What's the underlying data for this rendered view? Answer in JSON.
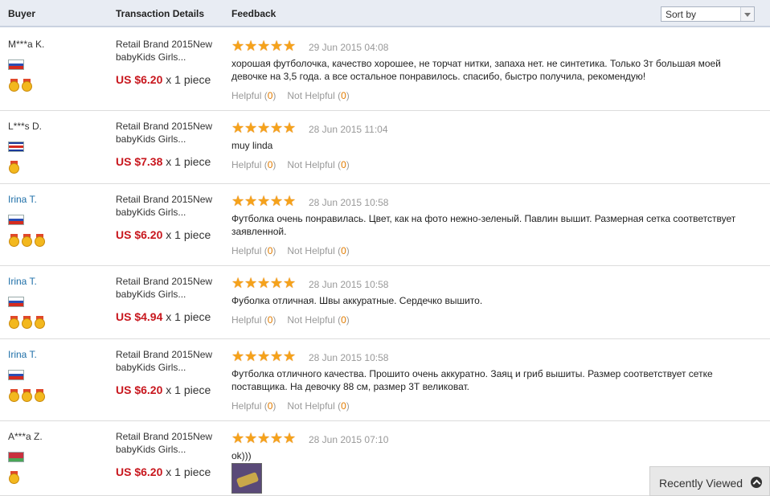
{
  "header": {
    "buyer_label": "Buyer",
    "transaction_label": "Transaction Details",
    "feedback_label": "Feedback",
    "sort_label": "Sort by"
  },
  "reviews": [
    {
      "buyer": "M***a K.",
      "buyer_is_link": false,
      "flag": "russia",
      "medal_count": 2,
      "product": "Retail Brand 2015New babyKids Girls...",
      "price": "US $6.20",
      "quantity": "x 1 piece",
      "rating": 5,
      "date": "29 Jun 2015 04:08",
      "text": "хорошая футболочка, качество хорошее, не торчат нитки, запаха нет. не синтетика. Только 3т большая моей девочке на 3,5 года. а все остальное понравилось. спасибо, быстро получила, рекомендую!",
      "helpful_label": "Helpful",
      "helpful_count": "0",
      "not_helpful_label": "Not Helpful",
      "not_helpful_count": "0"
    },
    {
      "buyer": "L***s D.",
      "buyer_is_link": false,
      "flag": "costa-rica",
      "medal_count": 1,
      "product": "Retail Brand 2015New babyKids Girls...",
      "price": "US $7.38",
      "quantity": "x 1 piece",
      "rating": 5,
      "date": "28 Jun 2015 11:04",
      "text": "muy linda",
      "helpful_label": "Helpful",
      "helpful_count": "0",
      "not_helpful_label": "Not Helpful",
      "not_helpful_count": "0"
    },
    {
      "buyer": "Irina T.",
      "buyer_is_link": true,
      "flag": "russia",
      "medal_count": 3,
      "product": "Retail Brand 2015New babyKids Girls...",
      "price": "US $6.20",
      "quantity": "x 1 piece",
      "rating": 5,
      "date": "28 Jun 2015 10:58",
      "text": "Футболка очень понравилась. Цвет, как на фото нежно-зеленый. Павлин вышит. Размерная сетка соответствует заявленной.",
      "helpful_label": "Helpful",
      "helpful_count": "0",
      "not_helpful_label": "Not Helpful",
      "not_helpful_count": "0"
    },
    {
      "buyer": "Irina T.",
      "buyer_is_link": true,
      "flag": "russia",
      "medal_count": 3,
      "product": "Retail Brand 2015New babyKids Girls...",
      "price": "US $4.94",
      "quantity": "x 1 piece",
      "rating": 5,
      "date": "28 Jun 2015 10:58",
      "text": "Фуболка отличная. Швы аккуратные. Сердечко вышито.",
      "helpful_label": "Helpful",
      "helpful_count": "0",
      "not_helpful_label": "Not Helpful",
      "not_helpful_count": "0"
    },
    {
      "buyer": "Irina T.",
      "buyer_is_link": true,
      "flag": "russia",
      "medal_count": 3,
      "product": "Retail Brand 2015New babyKids Girls...",
      "price": "US $6.20",
      "quantity": "x 1 piece",
      "rating": 5,
      "date": "28 Jun 2015 10:58",
      "text": "Футболка отличного качества. Прошито очень аккуратно. Заяц и гриб вышиты. Размер соответствует сетке поставщика. На девочку 88 см, размер 3Т великоват.",
      "helpful_label": "Helpful",
      "helpful_count": "0",
      "not_helpful_label": "Not Helpful",
      "not_helpful_count": "0"
    },
    {
      "buyer": "A***a Z.",
      "buyer_is_link": false,
      "flag": "belarus",
      "medal_count": 1,
      "product": "Retail Brand 2015New babyKids Girls...",
      "price": "US $6.20",
      "quantity": "x 1 piece",
      "rating": 5,
      "date": "28 Jun 2015 07:10",
      "text": "ok)))",
      "has_photo": true
    }
  ],
  "recently_viewed": {
    "label": "Recently Viewed"
  },
  "colors": {
    "price": "#c8171e",
    "link": "#1e6fa8",
    "star": "#f5a21b",
    "count": "#e07b00",
    "header_bg": "#e8ecf3"
  },
  "icons": {
    "star": "star-icon",
    "medal": "medal-icon",
    "flag": "country-flag-icon",
    "chevron_up": "chevron-up-icon"
  }
}
